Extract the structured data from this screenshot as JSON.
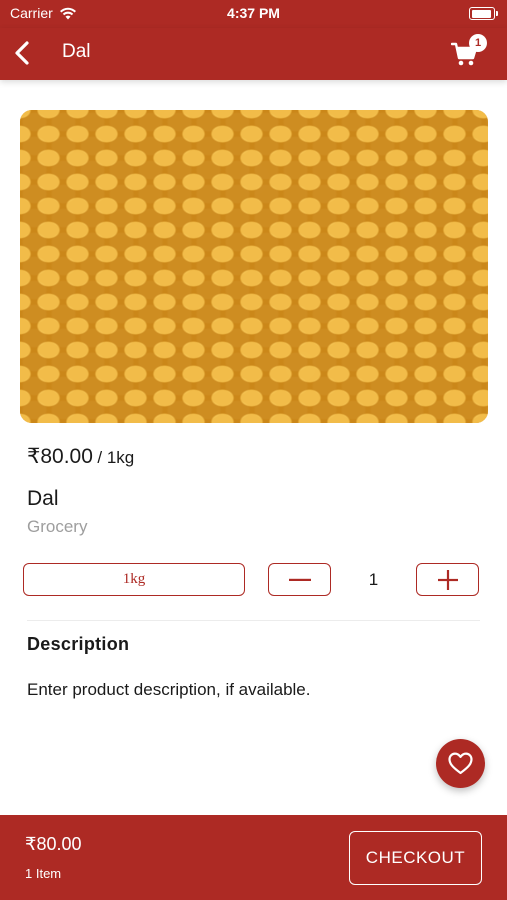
{
  "status_bar": {
    "carrier": "Carrier",
    "time": "4:37 PM",
    "wifi_icon": "wifi-icon",
    "battery_icon": "battery-icon"
  },
  "nav": {
    "title": "Dal",
    "back_icon": "chevron-left-icon",
    "cart_icon": "cart-icon",
    "cart_count": "1"
  },
  "product": {
    "image_alt": "Dal",
    "price": "₹80.00",
    "unit": "/ 1kg",
    "name": "Dal",
    "category": "Grocery",
    "selected_variant": "1kg",
    "quantity": "1",
    "description_heading": "Description",
    "description": "Enter product description, if available."
  },
  "favorite_icon": "heart-icon",
  "footer": {
    "total": "₹80.00",
    "items": "1 Item",
    "checkout_label": "CHECKOUT"
  },
  "colors": {
    "primary": "#ad2a24",
    "secondary_text": "#9e9e9e"
  }
}
